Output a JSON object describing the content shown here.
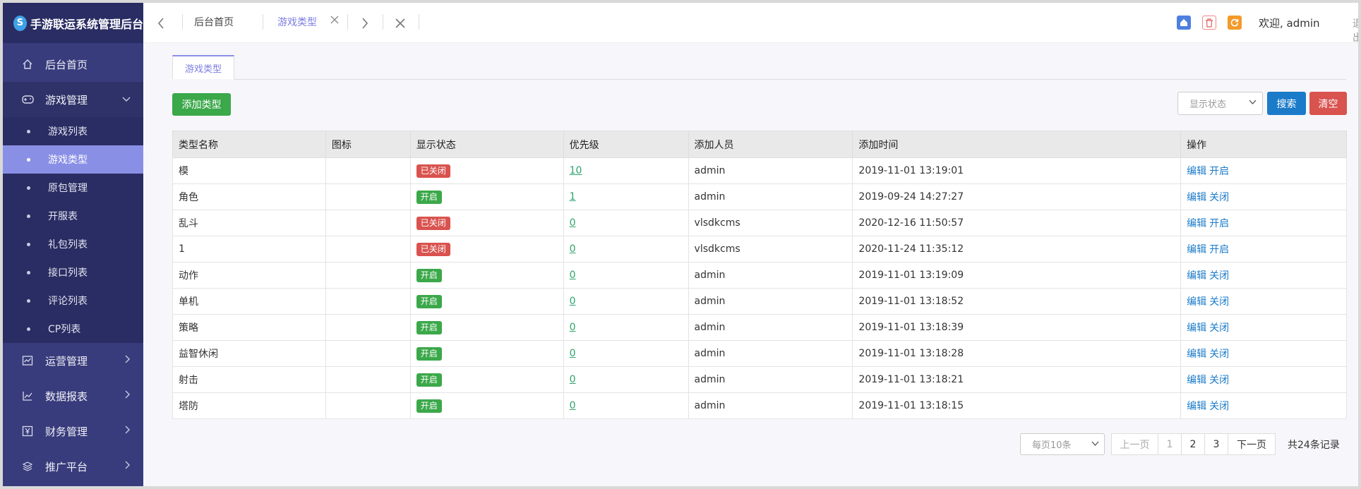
{
  "app": {
    "title": "手游联运系统管理后台"
  },
  "sidebar": {
    "top_items": [
      {
        "label": "后台首页",
        "icon": "home-icon"
      },
      {
        "label": "游戏管理",
        "icon": "gamepad-icon"
      }
    ],
    "sub_items": [
      "游戏列表",
      "游戏类型",
      "原包管理",
      "开服表",
      "礼包列表",
      "接口列表",
      "评论列表",
      "CP列表"
    ],
    "active_sub": "游戏类型",
    "bottom_items": [
      {
        "label": "运营管理",
        "icon": "chart-box-icon"
      },
      {
        "label": "数据报表",
        "icon": "line-chart-icon"
      },
      {
        "label": "财务管理",
        "icon": "yen-icon"
      },
      {
        "label": "推广平台",
        "icon": "layers-icon"
      }
    ]
  },
  "topbar": {
    "tab_home": "后台首页",
    "tab_active": "游戏类型",
    "welcome": "欢迎, admin",
    "logout": "退出"
  },
  "content": {
    "tab_label": "游戏类型",
    "add_button": "添加类型",
    "status_placeholder": "显示状态",
    "search_button": "搜索",
    "clear_button": "清空"
  },
  "table": {
    "headers": [
      "类型名称",
      "图标",
      "显示状态",
      "优先级",
      "添加人员",
      "添加时间",
      "操作"
    ],
    "rows": [
      {
        "name": "模",
        "status": "已关闭",
        "status_on": false,
        "priority": "10",
        "user": "admin",
        "time": "2019-11-01 13:19:01",
        "edit": "编辑",
        "toggle": "开启"
      },
      {
        "name": "角色",
        "status": "开启",
        "status_on": true,
        "priority": "1",
        "user": "admin",
        "time": "2019-09-24 14:27:27",
        "edit": "编辑",
        "toggle": "关闭"
      },
      {
        "name": "乱斗",
        "status": "已关闭",
        "status_on": false,
        "priority": "0",
        "user": "vlsdkcms",
        "time": "2020-12-16 11:50:57",
        "edit": "编辑",
        "toggle": "开启"
      },
      {
        "name": "1",
        "status": "已关闭",
        "status_on": false,
        "priority": "0",
        "user": "vlsdkcms",
        "time": "2020-11-24 11:35:12",
        "edit": "编辑",
        "toggle": "开启"
      },
      {
        "name": "动作",
        "status": "开启",
        "status_on": true,
        "priority": "0",
        "user": "admin",
        "time": "2019-11-01 13:19:09",
        "edit": "编辑",
        "toggle": "关闭"
      },
      {
        "name": "单机",
        "status": "开启",
        "status_on": true,
        "priority": "0",
        "user": "admin",
        "time": "2019-11-01 13:18:52",
        "edit": "编辑",
        "toggle": "关闭"
      },
      {
        "name": "策略",
        "status": "开启",
        "status_on": true,
        "priority": "0",
        "user": "admin",
        "time": "2019-11-01 13:18:39",
        "edit": "编辑",
        "toggle": "关闭"
      },
      {
        "name": "益智休闲",
        "status": "开启",
        "status_on": true,
        "priority": "0",
        "user": "admin",
        "time": "2019-11-01 13:18:28",
        "edit": "编辑",
        "toggle": "关闭"
      },
      {
        "name": "射击",
        "status": "开启",
        "status_on": true,
        "priority": "0",
        "user": "admin",
        "time": "2019-11-01 13:18:21",
        "edit": "编辑",
        "toggle": "关闭"
      },
      {
        "name": "塔防",
        "status": "开启",
        "status_on": true,
        "priority": "0",
        "user": "admin",
        "time": "2019-11-01 13:18:15",
        "edit": "编辑",
        "toggle": "关闭"
      }
    ]
  },
  "pagination": {
    "page_size": "每页10条",
    "prev": "上一页",
    "pages": [
      "1",
      "2",
      "3"
    ],
    "next": "下一页",
    "total": "共24条记录"
  },
  "colors": {
    "sidebar_bg": "#383c7c",
    "accent": "#8a8fe6",
    "success": "#3ba84a",
    "danger": "#d9534f",
    "primary": "#1b7bc9"
  }
}
